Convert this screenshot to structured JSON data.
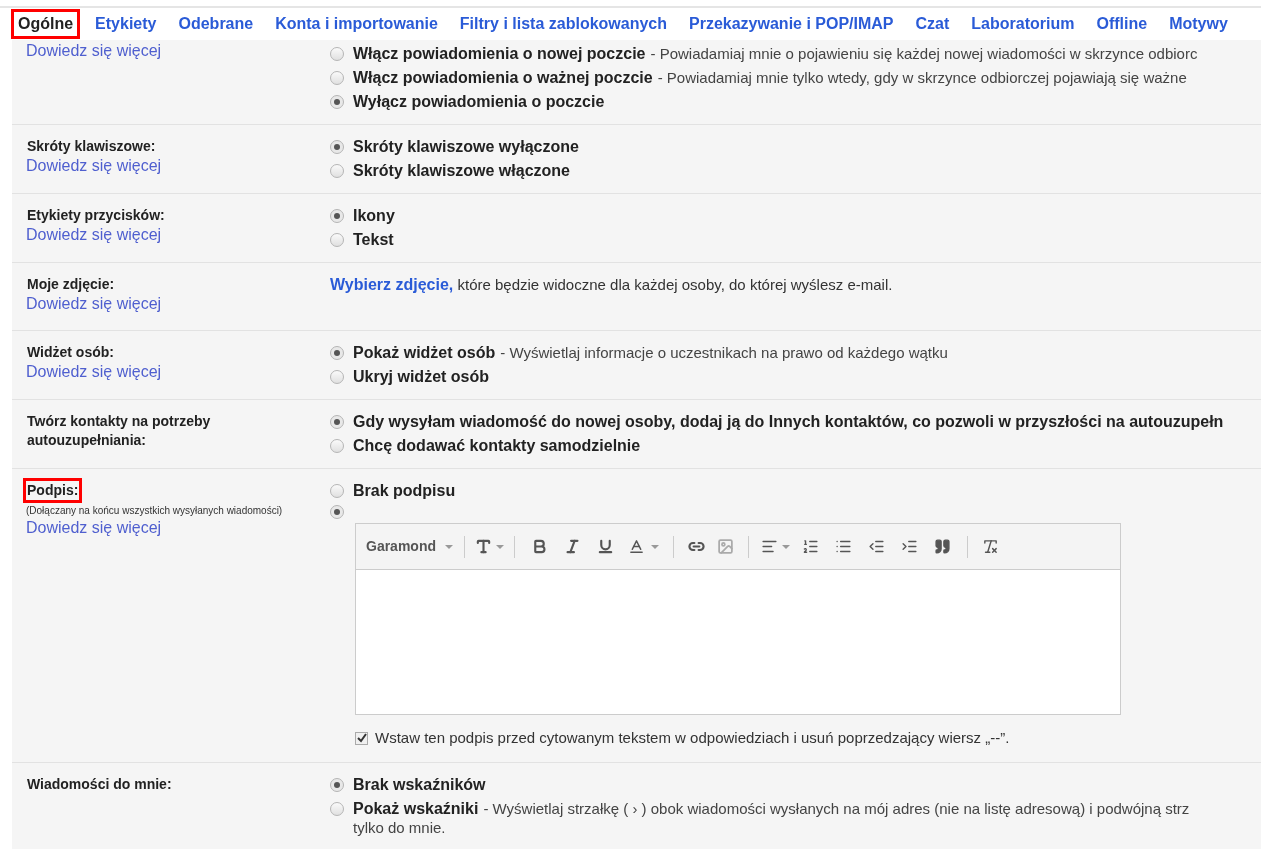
{
  "tabs": [
    {
      "label": "Ogólne",
      "selected": true,
      "highlighted": true
    },
    {
      "label": "Etykiety",
      "selected": false,
      "highlighted": false
    },
    {
      "label": "Odebrane",
      "selected": false,
      "highlighted": false
    },
    {
      "label": "Konta i importowanie",
      "selected": false,
      "highlighted": false
    },
    {
      "label": "Filtry i lista zablokowanych",
      "selected": false,
      "highlighted": false
    },
    {
      "label": "Przekazywanie i POP/IMAP",
      "selected": false,
      "highlighted": false
    },
    {
      "label": "Czat",
      "selected": false,
      "highlighted": false
    },
    {
      "label": "Laboratorium",
      "selected": false,
      "highlighted": false
    },
    {
      "label": "Offline",
      "selected": false,
      "highlighted": false
    },
    {
      "label": "Motywy",
      "selected": false,
      "highlighted": false
    }
  ],
  "rows": [
    {
      "kind": "radios",
      "link": "Dowiedz się więcej",
      "options": [
        {
          "label": "Włącz powiadomienia o nowej poczcie",
          "description": "- Powiadamiaj mnie o pojawieniu się każdej nowej wiadomości w skrzynce odbiorc",
          "selected": false
        },
        {
          "label": "Włącz powiadomienia o ważnej poczcie",
          "description": "- Powiadamiaj mnie tylko wtedy, gdy w skrzynce odbiorczej pojawiają się ważne",
          "selected": false
        },
        {
          "label": "Wyłącz powiadomienia o poczcie",
          "selected": true
        }
      ]
    },
    {
      "kind": "radios",
      "label": "Skróty klawiszowe:",
      "highlighted": false,
      "link": "Dowiedz się więcej",
      "options": [
        {
          "label": "Skróty klawiszowe wyłączone",
          "selected": true
        },
        {
          "label": "Skróty klawiszowe włączone",
          "selected": false
        }
      ]
    },
    {
      "kind": "radios",
      "label": "Etykiety przycisków:",
      "highlighted": false,
      "link": "Dowiedz się więcej",
      "options": [
        {
          "label": "Ikony",
          "selected": true
        },
        {
          "label": "Tekst",
          "selected": false
        }
      ]
    },
    {
      "kind": "photo",
      "label": "Moje zdjęcie:",
      "highlighted": false,
      "link": "Dowiedz się więcej",
      "action": "Wybierz zdjęcie,",
      "text": "które będzie widoczne dla każdej osoby, do której wyślesz e-mail."
    },
    {
      "kind": "radios",
      "label": "Widżet osób:",
      "highlighted": false,
      "link": "Dowiedz się więcej",
      "options": [
        {
          "label": "Pokaż widżet osób",
          "description": "- Wyświetlaj informacje o uczestnikach na prawo od każdego wątku",
          "selected": true
        },
        {
          "label": "Ukryj widżet osób",
          "selected": false
        }
      ]
    },
    {
      "kind": "radios",
      "label": "Twórz kontakty na potrzeby autouzupełniania:",
      "highlighted": false,
      "options": [
        {
          "label": "Gdy wysyłam wiadomość do nowej osoby, dodaj ją do Innych kontaktów, co pozwoli w przyszłości na autouzupełn",
          "selected": true
        },
        {
          "label": "Chcę dodawać kontakty samodzielnie",
          "selected": false
        }
      ]
    },
    {
      "kind": "signature",
      "label": "Podpis:",
      "highlighted": true,
      "note": "(Dołączany na końcu wszystkich wysyłanych wiadomości)",
      "link": "Dowiedz się więcej",
      "options": [
        {
          "label": "Brak podpisu",
          "selected": false
        },
        {
          "selected": true
        }
      ],
      "font": "Garamond",
      "checkbox": {
        "label": "Wstaw ten podpis przed cytowanym tekstem w odpowiedziach i usuń poprzedzający wiersz „--”.",
        "checked": true
      }
    },
    {
      "kind": "radios",
      "label": "Wiadomości do mnie:",
      "highlighted": false,
      "options": [
        {
          "label": "Brak wskaźników",
          "selected": true
        },
        {
          "label": "Pokaż wskaźniki",
          "description": "- Wyświetlaj strzałkę ( › ) obok wiadomości wysłanych na mój adres (nie na listę adresową) i podwójną strz",
          "continuation": "tylko do mnie.",
          "selected": false
        }
      ]
    }
  ]
}
